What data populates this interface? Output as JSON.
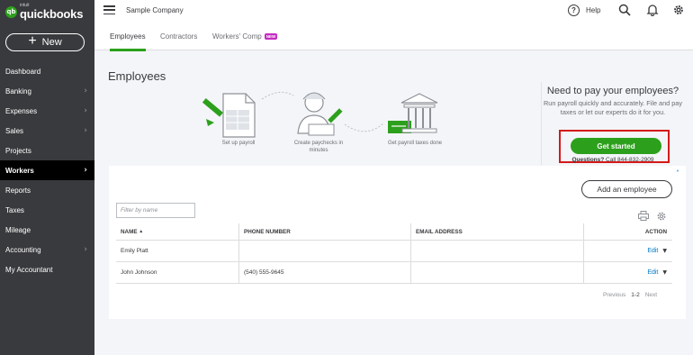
{
  "brand": {
    "mark": "qb",
    "small": "intuit",
    "name": "quickbooks"
  },
  "sidebar": {
    "new_label": "New",
    "items": [
      {
        "label": "Dashboard",
        "chevron": false,
        "active": false
      },
      {
        "label": "Banking",
        "chevron": true,
        "active": false
      },
      {
        "label": "Expenses",
        "chevron": true,
        "active": false
      },
      {
        "label": "Sales",
        "chevron": true,
        "active": false
      },
      {
        "label": "Projects",
        "chevron": false,
        "active": false
      },
      {
        "label": "Workers",
        "chevron": true,
        "active": true
      },
      {
        "label": "Reports",
        "chevron": false,
        "active": false
      },
      {
        "label": "Taxes",
        "chevron": false,
        "active": false
      },
      {
        "label": "Mileage",
        "chevron": false,
        "active": false
      },
      {
        "label": "Accounting",
        "chevron": true,
        "active": false
      },
      {
        "label": "My Accountant",
        "chevron": false,
        "active": false
      }
    ]
  },
  "topbar": {
    "company": "Sample Company",
    "help_label": "Help",
    "help_glyph": "?"
  },
  "tabs": [
    {
      "label": "Employees",
      "active": true
    },
    {
      "label": "Contractors",
      "active": false
    },
    {
      "label": "Workers' Comp",
      "active": false,
      "badge": "NEW"
    }
  ],
  "page": {
    "title": "Employees"
  },
  "promo": {
    "steps": [
      "Set up payroll",
      "Create paychecks in minutes",
      "Get payroll taxes done"
    ],
    "title": "Need to pay your employees?",
    "description": "Run payroll quickly and accurately. File and pay taxes or let our experts do it for you.",
    "cta": "Get started",
    "questions_label": "Questions?",
    "questions_phone": "Call 844-832-2909"
  },
  "table": {
    "add_button": "Add an employee",
    "filter_placeholder": "Filter by name",
    "columns": {
      "name": "NAME",
      "sort_glyph": "▲",
      "phone": "PHONE NUMBER",
      "email": "EMAIL ADDRESS",
      "action": "ACTION"
    },
    "rows": [
      {
        "name": "Emily Platt",
        "phone": "",
        "email": "",
        "action": "Edit"
      },
      {
        "name": "John Johnson",
        "phone": "(540) 555-9645",
        "email": "",
        "action": "Edit"
      }
    ],
    "pager": {
      "previous": "Previous",
      "range": "1-2",
      "next": "Next"
    }
  },
  "colors": {
    "green": "#2ca01c",
    "sidebar": "#393a3d",
    "link": "#0077c5",
    "highlight": "#d41a1a",
    "badge": "#c52cc1"
  }
}
